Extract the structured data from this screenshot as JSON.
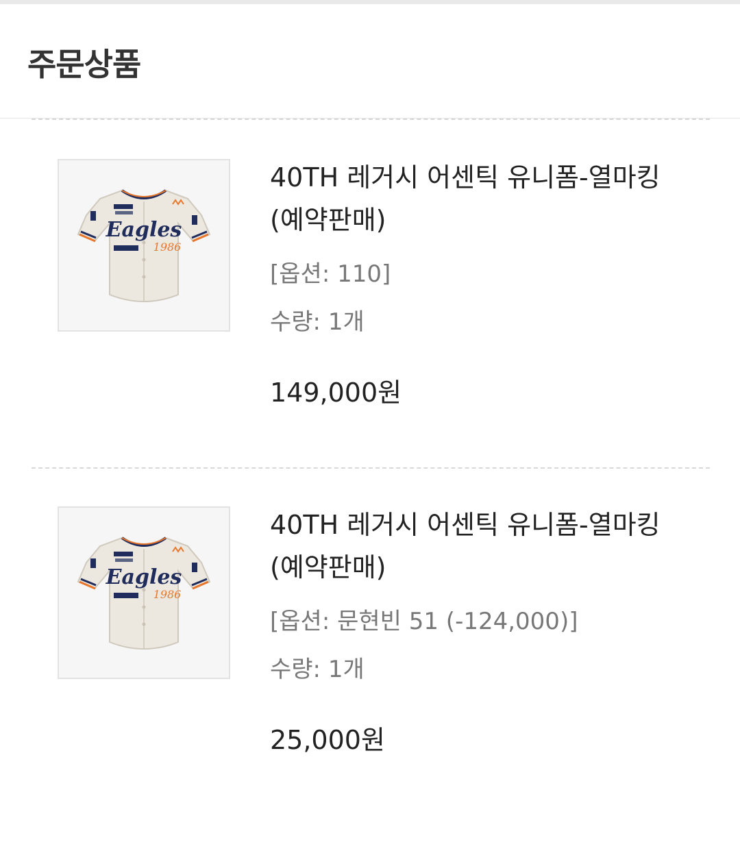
{
  "section": {
    "title": "주문상품"
  },
  "items": [
    {
      "name": "40TH 레거시 어센틱 유니폼-열마킹 (예약판매)",
      "option": "[옵션: 110]",
      "quantity": "수량: 1개",
      "price": "149,000원",
      "image": {
        "icon": "baseball-jersey",
        "logo": "Eagles",
        "year": "1986"
      }
    },
    {
      "name": "40TH 레거시 어센틱 유니폼-열마킹 (예약판매)",
      "option": "[옵션: 문현빈 51 (-124,000)]",
      "quantity": "수량: 1개",
      "price": "25,000원",
      "image": {
        "icon": "baseball-jersey",
        "logo": "Eagles",
        "year": "1986"
      }
    }
  ],
  "colors": {
    "jersey": "#ece8e0",
    "logo": "#1f2c5c",
    "accent": "#e8772c"
  }
}
